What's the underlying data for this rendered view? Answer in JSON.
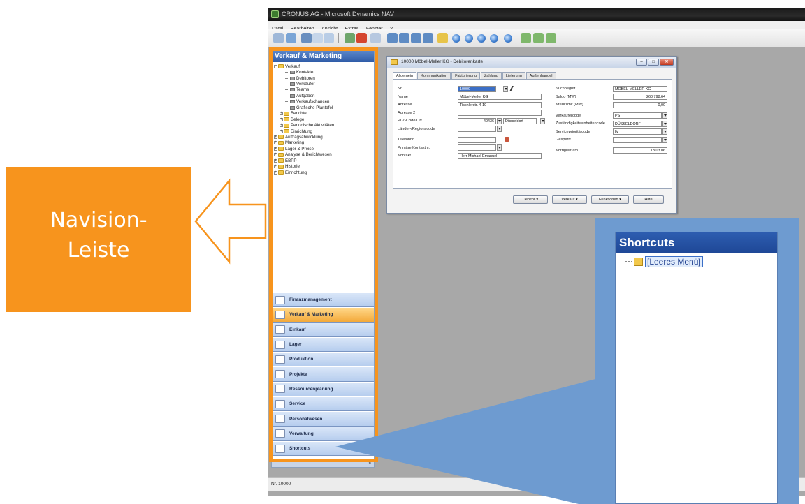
{
  "app": {
    "window_title": "CRONUS AG - Microsoft Dynamics NAV",
    "menu": [
      "Datei",
      "Bearbeiten",
      "Ansicht",
      "Extras",
      "Fenster",
      "?"
    ],
    "status_text": "Nr. 10000"
  },
  "nav": {
    "header": "Verkauf & Marketing",
    "tree": [
      {
        "label": "Verkauf",
        "level": 0,
        "kind": "folder",
        "expander": "-"
      },
      {
        "label": "Kontakte",
        "level": 2,
        "kind": "leaf"
      },
      {
        "label": "Debitoren",
        "level": 2,
        "kind": "leaf"
      },
      {
        "label": "Verkäufer",
        "level": 2,
        "kind": "leaf"
      },
      {
        "label": "Teams",
        "level": 2,
        "kind": "leaf"
      },
      {
        "label": "Aufgaben",
        "level": 2,
        "kind": "leaf"
      },
      {
        "label": "Verkaufschancen",
        "level": 2,
        "kind": "leaf"
      },
      {
        "label": "Grafische Plantafel",
        "level": 2,
        "kind": "leaf"
      },
      {
        "label": "Berichte",
        "level": 1,
        "kind": "folder",
        "expander": "+"
      },
      {
        "label": "Belege",
        "level": 1,
        "kind": "folder",
        "expander": "+"
      },
      {
        "label": "Periodische Aktivitäten",
        "level": 1,
        "kind": "folder",
        "expander": "+"
      },
      {
        "label": "Einrichtung",
        "level": 1,
        "kind": "folder",
        "expander": "+"
      },
      {
        "label": "Auftragsabwicklung",
        "level": 0,
        "kind": "folder",
        "expander": "+"
      },
      {
        "label": "Marketing",
        "level": 0,
        "kind": "folder",
        "expander": "+"
      },
      {
        "label": "Lager & Preise",
        "level": 0,
        "kind": "folder",
        "expander": "+"
      },
      {
        "label": "Analyse & Berichtwesen",
        "level": 0,
        "kind": "folder",
        "expander": "+"
      },
      {
        "label": "EBPP",
        "level": 0,
        "kind": "folder",
        "expander": "+"
      },
      {
        "label": "Historie",
        "level": 0,
        "kind": "folder",
        "expander": "+"
      },
      {
        "label": "Einrichtung",
        "level": 0,
        "kind": "folder",
        "expander": "+"
      }
    ],
    "buttons": [
      {
        "label": "Finanzmanagement",
        "active": false
      },
      {
        "label": "Verkauf & Marketing",
        "active": true
      },
      {
        "label": "Einkauf",
        "active": false
      },
      {
        "label": "Lager",
        "active": false
      },
      {
        "label": "Produktion",
        "active": false
      },
      {
        "label": "Projekte",
        "active": false
      },
      {
        "label": "Ressourcenplanung",
        "active": false
      },
      {
        "label": "Service",
        "active": false
      },
      {
        "label": "Personalwesen",
        "active": false
      },
      {
        "label": "Verwaltung",
        "active": false
      },
      {
        "label": "Shortcuts",
        "active": false
      }
    ]
  },
  "card": {
    "title": "10000 Möbel-Meller KG - Debitorenkarte",
    "tabs": [
      "Allgemein",
      "Kommunikation",
      "Fakturierung",
      "Zahlung",
      "Lieferung",
      "Außenhandel"
    ],
    "left_fields": [
      {
        "label": "Nr.",
        "value": "10000",
        "selected": true
      },
      {
        "label": "Name",
        "value": "Möbel-Meller KG"
      },
      {
        "label": "Adresse",
        "value": "Tischlerstr. 4-10"
      },
      {
        "label": "Adresse 2",
        "value": ""
      },
      {
        "label": "PLZ-Code/Ort",
        "value": "40436",
        "value2": "Düsseldorf"
      },
      {
        "label": "Länder-/Regionscode",
        "value": ""
      },
      {
        "label": "Telefonnr.",
        "value": ""
      },
      {
        "label": "Primäre Kontaktnr.",
        "value": ""
      },
      {
        "label": "Kontakt",
        "value": "Herr Michael Emanuel"
      }
    ],
    "right_fields": [
      {
        "label": "Suchbegriff",
        "value": "MÖBEL-MELLER KG"
      },
      {
        "label": "Saldo (MW)",
        "value": "260.798,64"
      },
      {
        "label": "Kreditlimit (MW)",
        "value": "0,00"
      },
      {
        "label": "Verkäufercode",
        "value": "PS"
      },
      {
        "label": "Zuständigkeitseinheitencode",
        "value": "DÜSSELDORF"
      },
      {
        "label": "Serviceprioritätcode",
        "value": "IV"
      },
      {
        "label": "Gesperrt",
        "value": ""
      },
      {
        "label": "Korrigiert am",
        "value": "13.03.06"
      }
    ],
    "buttons": [
      "Debitor",
      "Verkauf",
      "Funktionen",
      "Hilfe"
    ]
  },
  "callout": {
    "line1": "Navision-",
    "line2": "Leiste"
  },
  "shortcuts": {
    "header": "Shortcuts",
    "item": "[Leeres Menü]"
  },
  "colors": {
    "orange": "#f7941d",
    "callout_blue": "#6e9bd0",
    "nav_header_blue": "#2f5ca8"
  }
}
